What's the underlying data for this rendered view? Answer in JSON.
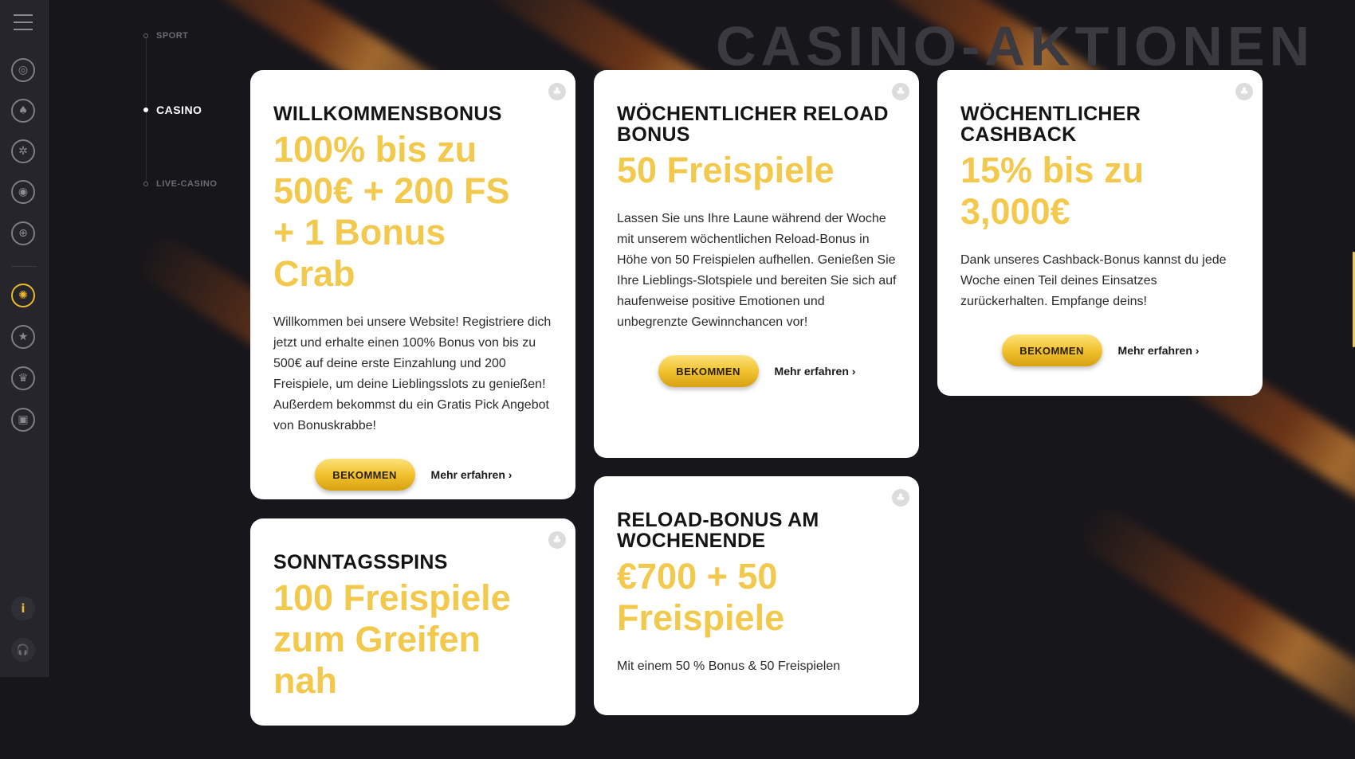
{
  "nav": {
    "items": [
      {
        "label": "SPORT",
        "active": false
      },
      {
        "label": "CASINO",
        "active": true
      },
      {
        "label": "LIVE-CASINO",
        "active": false
      }
    ]
  },
  "sidebar": {
    "icons": [
      "menu-icon",
      "film-reel-icon",
      "spade-icon",
      "roulette-icon",
      "live-signal-icon",
      "globe-icon",
      "casino-chip-icon",
      "star-icon",
      "trophy-icon",
      "shop-icon"
    ],
    "info_label": "i",
    "support_label": "🎧"
  },
  "heading": "CASINO-AKTIONEN",
  "cards": [
    {
      "title": "WILLKOMMENSBONUS",
      "offer": "100% bis zu 500€ + 200 FS + 1 Bonus Crab",
      "text": "Willkommen bei unsere Website! Registriere dich jetzt und erhalte einen 100% Bonus von bis zu 500€ auf deine erste Einzahlung und 200 Freispiele, um deine Lieblingsslots zu genießen! Außerdem bekommst du ein Gratis Pick Angebot von Bonuskrabbe!",
      "button": "BEKOMMEN",
      "more": "Mehr erfahren ›"
    },
    {
      "title": "WÖCHENTLICHER RELOAD BONUS",
      "offer": "50 Freispiele",
      "text": "Lassen Sie uns Ihre Laune während der Woche mit unserem wöchentlichen Reload-Bonus in Höhe von 50 Freispielen aufhellen. Genießen Sie Ihre Lieblings-Slotspiele und bereiten Sie sich auf haufenweise positive Emotionen und unbegrenzte Gewinnchancen vor!",
      "button": "BEKOMMEN",
      "more": "Mehr erfahren ›"
    },
    {
      "title": "WÖCHENTLICHER CASHBACK",
      "offer": "15% bis zu 3,000€",
      "text": "Dank unseres Cashback-Bonus kannst du jede Woche einen Teil deines Einsatzes zurückerhalten. Empfange deins!",
      "button": "BEKOMMEN",
      "more": "Mehr erfahren ›"
    },
    {
      "title": "SONNTAGSSPINS",
      "offer": "100 Freispiele zum Greifen nah"
    },
    {
      "title": "RELOAD-BONUS AM WOCHENENDE",
      "offer": "€700 + 50 Freispiele",
      "text": "Mit einem 50 % Bonus & 50 Freispielen"
    }
  ]
}
